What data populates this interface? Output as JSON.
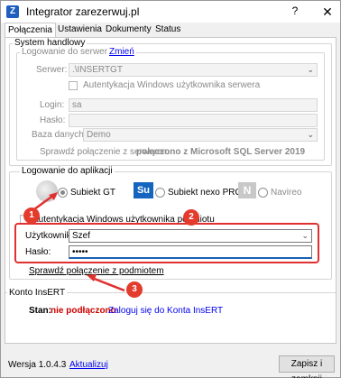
{
  "window": {
    "title": "Integrator zarezerwuj.pl",
    "help": "?",
    "close": "✕"
  },
  "tabs": [
    "Połączenia",
    "Ustawienia",
    "Dokumenty",
    "Status"
  ],
  "system": {
    "legend": "System handlowy",
    "sql_legend": "Logowanie do serwera SQL",
    "change_link": "Zmień",
    "server_label": "Serwer:",
    "server_value": ".\\INSERTGT",
    "windows_auth_server": "Autentykacja Windows użytkownika serwera",
    "login_label": "Login:",
    "login_value": "sa",
    "password_label": "Hasło:",
    "password_value": "",
    "db_label": "Baza danych:",
    "db_value": "Demo",
    "check_server": "Sprawdź połączenie z serwerem",
    "server_status": "połączono z Microsoft SQL Server 2019"
  },
  "app_login": {
    "legend": "Logowanie do aplikacji",
    "opt_gt": "Subiekt GT",
    "opt_nexo": "Subiekt nexo PRO",
    "opt_navireo": "Navireo",
    "windows_auth_entity": "Autentykacja Windows użytkownika podmiotu",
    "user_label": "Użytkownik:",
    "user_value": "Szef",
    "password_label": "Hasło:",
    "password_value": "•••••",
    "check_entity": "Sprawdź połączenie z podmiotem"
  },
  "insert": {
    "legend": "Konto InsERT",
    "status_label": "Stan:",
    "status_value": "nie podłączono",
    "login_link": "Zaloguj się do Konta InsERT"
  },
  "annotations": [
    "1",
    "2",
    "3"
  ],
  "footer": {
    "version": "Wersja 1.0.4.3",
    "update_link": "Aktualizuj",
    "save_button": "Zapisz i zamknij"
  },
  "colors": {
    "annotation_red": "#e03030",
    "status_red": "#cc0000",
    "link_blue": "#0000ee",
    "subiekt_blue": "#1565c0"
  }
}
